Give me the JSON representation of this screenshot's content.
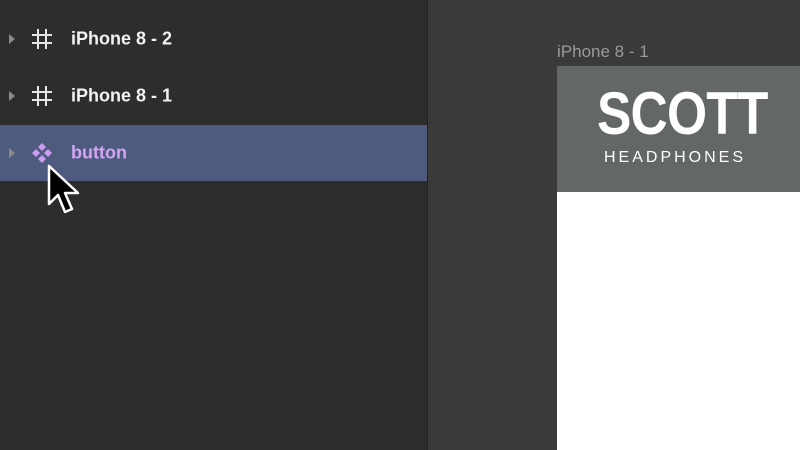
{
  "layers": [
    {
      "label": "iPhone 8 - 2",
      "icon": "artboard-hash-icon",
      "selected": false
    },
    {
      "label": "iPhone 8 - 1",
      "icon": "artboard-hash-icon",
      "selected": false
    },
    {
      "label": "button",
      "icon": "component-diamond-icon",
      "selected": true
    }
  ],
  "canvas": {
    "artboard_title": "iPhone 8 - 1",
    "logo": {
      "wordmark": "SCOTT",
      "subtitle": "HEADPHONES"
    }
  },
  "colors": {
    "panel_bg": "#2d2d2d",
    "canvas_bg": "#3a3a3a",
    "selection": "#4e5b7e",
    "component_label": "#d4a5f5",
    "header_bar": "#636866"
  }
}
